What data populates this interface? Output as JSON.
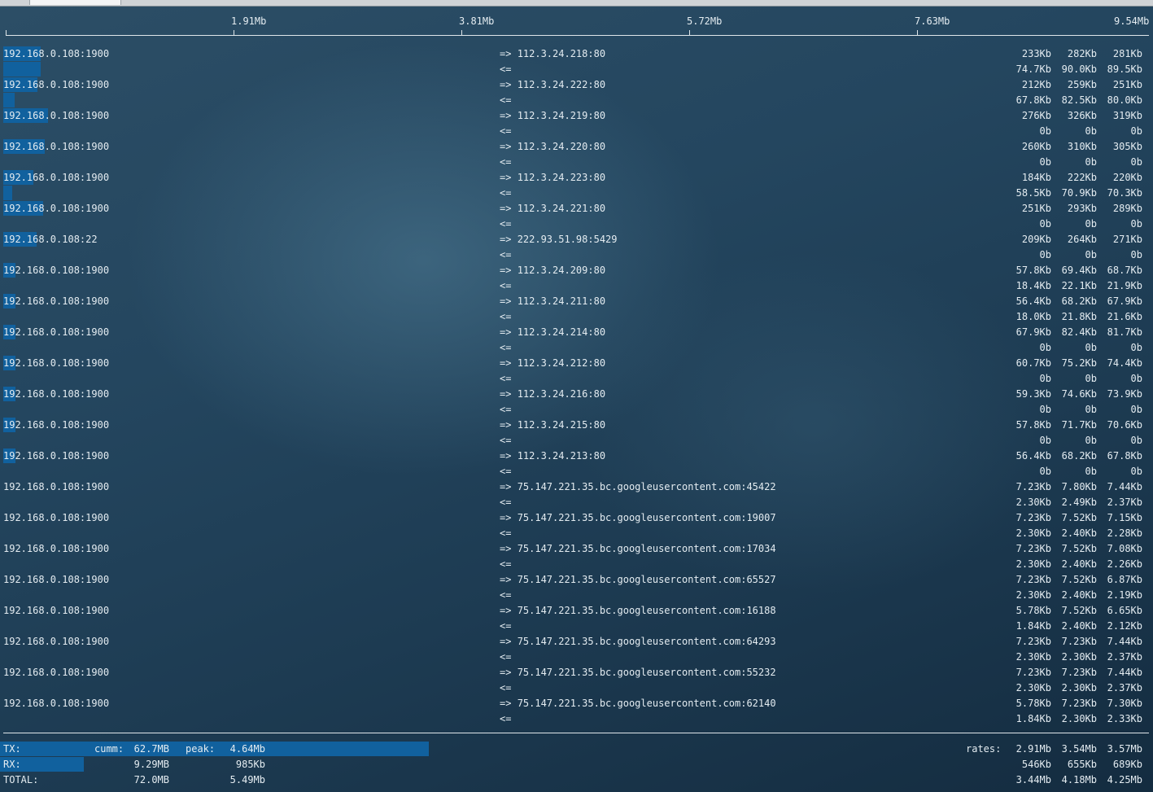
{
  "scale": [
    "1.91Mb",
    "3.81Mb",
    "5.72Mb",
    "7.63Mb",
    "9.54Mb"
  ],
  "connections": [
    {
      "src": "192.168.0.108:1900",
      "dst": "112.3.24.218:80",
      "tx": [
        "233Kb",
        "282Kb",
        "281Kb"
      ],
      "rx": [
        "74.7Kb",
        "90.0Kb",
        "89.5Kb"
      ],
      "tx_fill": 0.033,
      "rx_fill": 0.033
    },
    {
      "src": "192.168.0.108:1900",
      "dst": "112.3.24.222:80",
      "tx": [
        "212Kb",
        "259Kb",
        "251Kb"
      ],
      "rx": [
        "67.8Kb",
        "82.5Kb",
        "80.0Kb"
      ],
      "tx_fill": 0.03,
      "rx_fill": 0.01
    },
    {
      "src": "192.168.0.108:1900",
      "dst": "112.3.24.219:80",
      "tx": [
        "276Kb",
        "326Kb",
        "319Kb"
      ],
      "rx": [
        "0b",
        "0b",
        "0b"
      ],
      "tx_fill": 0.039,
      "rx_fill": 0.0
    },
    {
      "src": "192.168.0.108:1900",
      "dst": "112.3.24.220:80",
      "tx": [
        "260Kb",
        "310Kb",
        "305Kb"
      ],
      "rx": [
        "0b",
        "0b",
        "0b"
      ],
      "tx_fill": 0.036,
      "rx_fill": 0.0
    },
    {
      "src": "192.168.0.108:1900",
      "dst": "112.3.24.223:80",
      "tx": [
        "184Kb",
        "222Kb",
        "220Kb"
      ],
      "rx": [
        "58.5Kb",
        "70.9Kb",
        "70.3Kb"
      ],
      "tx_fill": 0.026,
      "rx_fill": 0.008
    },
    {
      "src": "192.168.0.108:1900",
      "dst": "112.3.24.221:80",
      "tx": [
        "251Kb",
        "293Kb",
        "289Kb"
      ],
      "rx": [
        "0b",
        "0b",
        "0b"
      ],
      "tx_fill": 0.035,
      "rx_fill": 0.0
    },
    {
      "src": "192.168.0.108:22",
      "dst": "222.93.51.98:5429",
      "tx": [
        "209Kb",
        "264Kb",
        "271Kb"
      ],
      "rx": [
        "0b",
        "0b",
        "0b"
      ],
      "tx_fill": 0.029,
      "rx_fill": 0.0
    },
    {
      "src": "192.168.0.108:1900",
      "dst": "112.3.24.209:80",
      "tx": [
        "57.8Kb",
        "69.4Kb",
        "68.7Kb"
      ],
      "rx": [
        "18.4Kb",
        "22.1Kb",
        "21.9Kb"
      ],
      "tx_fill": 0.011,
      "rx_fill": 0.0
    },
    {
      "src": "192.168.0.108:1900",
      "dst": "112.3.24.211:80",
      "tx": [
        "56.4Kb",
        "68.2Kb",
        "67.9Kb"
      ],
      "rx": [
        "18.0Kb",
        "21.8Kb",
        "21.6Kb"
      ],
      "tx_fill": 0.011,
      "rx_fill": 0.0
    },
    {
      "src": "192.168.0.108:1900",
      "dst": "112.3.24.214:80",
      "tx": [
        "67.9Kb",
        "82.4Kb",
        "81.7Kb"
      ],
      "rx": [
        "0b",
        "0b",
        "0b"
      ],
      "tx_fill": 0.011,
      "rx_fill": 0.0
    },
    {
      "src": "192.168.0.108:1900",
      "dst": "112.3.24.212:80",
      "tx": [
        "60.7Kb",
        "75.2Kb",
        "74.4Kb"
      ],
      "rx": [
        "0b",
        "0b",
        "0b"
      ],
      "tx_fill": 0.011,
      "rx_fill": 0.0
    },
    {
      "src": "192.168.0.108:1900",
      "dst": "112.3.24.216:80",
      "tx": [
        "59.3Kb",
        "74.6Kb",
        "73.9Kb"
      ],
      "rx": [
        "0b",
        "0b",
        "0b"
      ],
      "tx_fill": 0.011,
      "rx_fill": 0.0
    },
    {
      "src": "192.168.0.108:1900",
      "dst": "112.3.24.215:80",
      "tx": [
        "57.8Kb",
        "71.7Kb",
        "70.6Kb"
      ],
      "rx": [
        "0b",
        "0b",
        "0b"
      ],
      "tx_fill": 0.011,
      "rx_fill": 0.0
    },
    {
      "src": "192.168.0.108:1900",
      "dst": "112.3.24.213:80",
      "tx": [
        "56.4Kb",
        "68.2Kb",
        "67.8Kb"
      ],
      "rx": [
        "0b",
        "0b",
        "0b"
      ],
      "tx_fill": 0.011,
      "rx_fill": 0.0
    },
    {
      "src": "192.168.0.108:1900",
      "dst": "75.147.221.35.bc.googleusercontent.com:45422",
      "tx": [
        "7.23Kb",
        "7.80Kb",
        "7.44Kb"
      ],
      "rx": [
        "2.30Kb",
        "2.49Kb",
        "2.37Kb"
      ],
      "tx_fill": 0.0,
      "rx_fill": 0.0
    },
    {
      "src": "192.168.0.108:1900",
      "dst": "75.147.221.35.bc.googleusercontent.com:19007",
      "tx": [
        "7.23Kb",
        "7.52Kb",
        "7.15Kb"
      ],
      "rx": [
        "2.30Kb",
        "2.40Kb",
        "2.28Kb"
      ],
      "tx_fill": 0.0,
      "rx_fill": 0.0
    },
    {
      "src": "192.168.0.108:1900",
      "dst": "75.147.221.35.bc.googleusercontent.com:17034",
      "tx": [
        "7.23Kb",
        "7.52Kb",
        "7.08Kb"
      ],
      "rx": [
        "2.30Kb",
        "2.40Kb",
        "2.26Kb"
      ],
      "tx_fill": 0.0,
      "rx_fill": 0.0
    },
    {
      "src": "192.168.0.108:1900",
      "dst": "75.147.221.35.bc.googleusercontent.com:65527",
      "tx": [
        "7.23Kb",
        "7.52Kb",
        "6.87Kb"
      ],
      "rx": [
        "2.30Kb",
        "2.40Kb",
        "2.19Kb"
      ],
      "tx_fill": 0.0,
      "rx_fill": 0.0
    },
    {
      "src": "192.168.0.108:1900",
      "dst": "75.147.221.35.bc.googleusercontent.com:16188",
      "tx": [
        "5.78Kb",
        "7.52Kb",
        "6.65Kb"
      ],
      "rx": [
        "1.84Kb",
        "2.40Kb",
        "2.12Kb"
      ],
      "tx_fill": 0.0,
      "rx_fill": 0.0
    },
    {
      "src": "192.168.0.108:1900",
      "dst": "75.147.221.35.bc.googleusercontent.com:64293",
      "tx": [
        "7.23Kb",
        "7.23Kb",
        "7.44Kb"
      ],
      "rx": [
        "2.30Kb",
        "2.30Kb",
        "2.37Kb"
      ],
      "tx_fill": 0.0,
      "rx_fill": 0.0
    },
    {
      "src": "192.168.0.108:1900",
      "dst": "75.147.221.35.bc.googleusercontent.com:55232",
      "tx": [
        "7.23Kb",
        "7.23Kb",
        "7.44Kb"
      ],
      "rx": [
        "2.30Kb",
        "2.30Kb",
        "2.37Kb"
      ],
      "tx_fill": 0.0,
      "rx_fill": 0.0
    },
    {
      "src": "192.168.0.108:1900",
      "dst": "75.147.221.35.bc.googleusercontent.com:62140",
      "tx": [
        "5.78Kb",
        "7.23Kb",
        "7.30Kb"
      ],
      "rx": [
        "1.84Kb",
        "2.30Kb",
        "2.33Kb"
      ],
      "tx_fill": 0.0,
      "rx_fill": 0.0
    }
  ],
  "labels": {
    "out": "=>",
    "in": "<="
  },
  "totals": {
    "tx_label": "TX:",
    "rx_label": "RX:",
    "total_label": "TOTAL:",
    "cumm_label": "cumm:",
    "peak_label": "peak:",
    "rates_label": "rates:",
    "tx_cumm": "62.7MB",
    "tx_peak": "4.64Mb",
    "tx_rates": [
      "2.91Mb",
      "3.54Mb",
      "3.57Mb"
    ],
    "rx_cumm": "9.29MB",
    "rx_peak": "985Kb",
    "rx_rates": [
      "546Kb",
      "655Kb",
      "689Kb"
    ],
    "total_cumm": "72.0MB",
    "total_peak": "5.49Mb",
    "total_rates": [
      "3.44Mb",
      "4.18Mb",
      "4.25Mb"
    ],
    "tx_fill": 0.374,
    "rx_fill": 0.073
  },
  "colors": {
    "bar": "#11619e",
    "text": "#e4ecf1"
  }
}
